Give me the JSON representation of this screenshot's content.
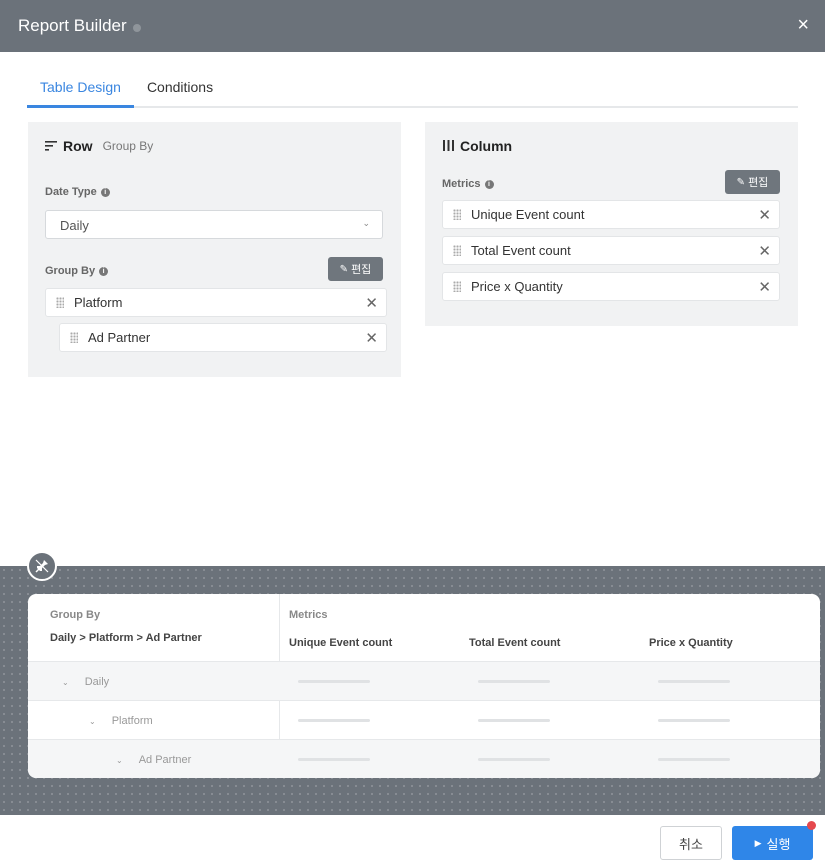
{
  "header": {
    "title": "Report Builder",
    "close_icon": "×"
  },
  "tabs": [
    {
      "label": "Table Design",
      "active": true
    },
    {
      "label": "Conditions",
      "active": false
    }
  ],
  "row_panel": {
    "title": "Row",
    "subtitle": "Group By",
    "date_type": {
      "label": "Date Type",
      "value": "Daily"
    },
    "group_by": {
      "label": "Group By",
      "edit_label": "편집",
      "items": [
        "Platform",
        "Ad Partner"
      ]
    }
  },
  "column_panel": {
    "title": "Column",
    "metrics": {
      "label": "Metrics",
      "edit_label": "편집",
      "items": [
        "Unique Event count",
        "Total Event count",
        "Price x Quantity"
      ]
    }
  },
  "preview": {
    "group_by_label": "Group By",
    "group_by_path": "Daily > Platform > Ad Partner",
    "metrics_label": "Metrics",
    "columns": [
      "Unique Event count",
      "Total Event count",
      "Price x Quantity"
    ],
    "rows": [
      "Daily",
      "Platform",
      "Ad Partner"
    ]
  },
  "footer": {
    "cancel_label": "취소",
    "run_label": "실행"
  },
  "colors": {
    "header": "#6b727a",
    "accent": "#3a86e0",
    "run": "#2f86e8",
    "badge": "#e5484d"
  }
}
